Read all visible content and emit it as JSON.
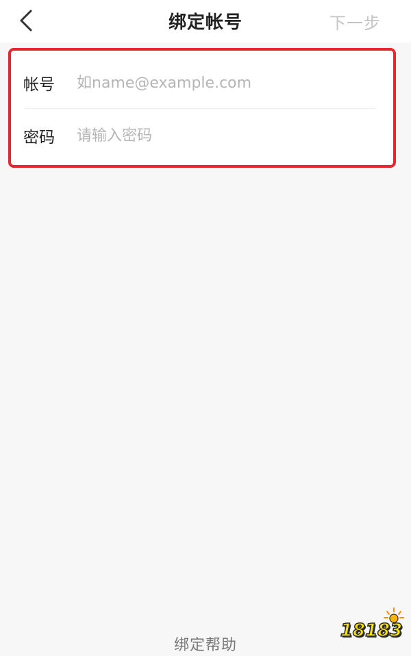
{
  "header": {
    "back_icon": "chevron-left-icon",
    "title": "绑定帐号",
    "next_label": "下一步"
  },
  "form": {
    "account": {
      "label": "帐号",
      "placeholder": "如name@example.com",
      "value": ""
    },
    "password": {
      "label": "密码",
      "placeholder": "请输入密码",
      "value": ""
    },
    "highlight_color": "#e5282d"
  },
  "footer": {
    "help_label": "绑定帮助"
  },
  "watermark": {
    "text": "18183"
  }
}
